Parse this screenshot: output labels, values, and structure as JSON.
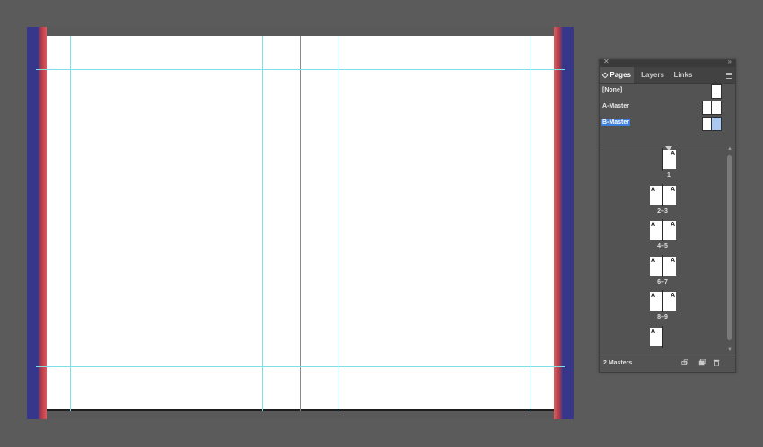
{
  "panel": {
    "tabs": [
      {
        "label": "◇ Pages"
      },
      {
        "label": "Layers"
      },
      {
        "label": "Links"
      }
    ],
    "masters": [
      {
        "label": "[None]"
      },
      {
        "label": "A-Master"
      },
      {
        "label": "B-Master"
      }
    ],
    "pages": [
      {
        "label": "1",
        "letters": [
          "A"
        ]
      },
      {
        "label": "2–3",
        "letters": [
          "A",
          "A"
        ]
      },
      {
        "label": "4–5",
        "letters": [
          "A",
          "A"
        ]
      },
      {
        "label": "6–7",
        "letters": [
          "A",
          "A"
        ]
      },
      {
        "label": "8–9",
        "letters": [
          "A",
          "A"
        ]
      },
      {
        "label": "",
        "letters": [
          "A"
        ]
      }
    ],
    "footer": {
      "status": "2 Masters"
    }
  },
  "colors": {
    "guide": "#7fdfe6",
    "bleed_outer": "#36378a",
    "bleed_inner": "#dd5a5e",
    "selection": "#3c7fdc"
  }
}
